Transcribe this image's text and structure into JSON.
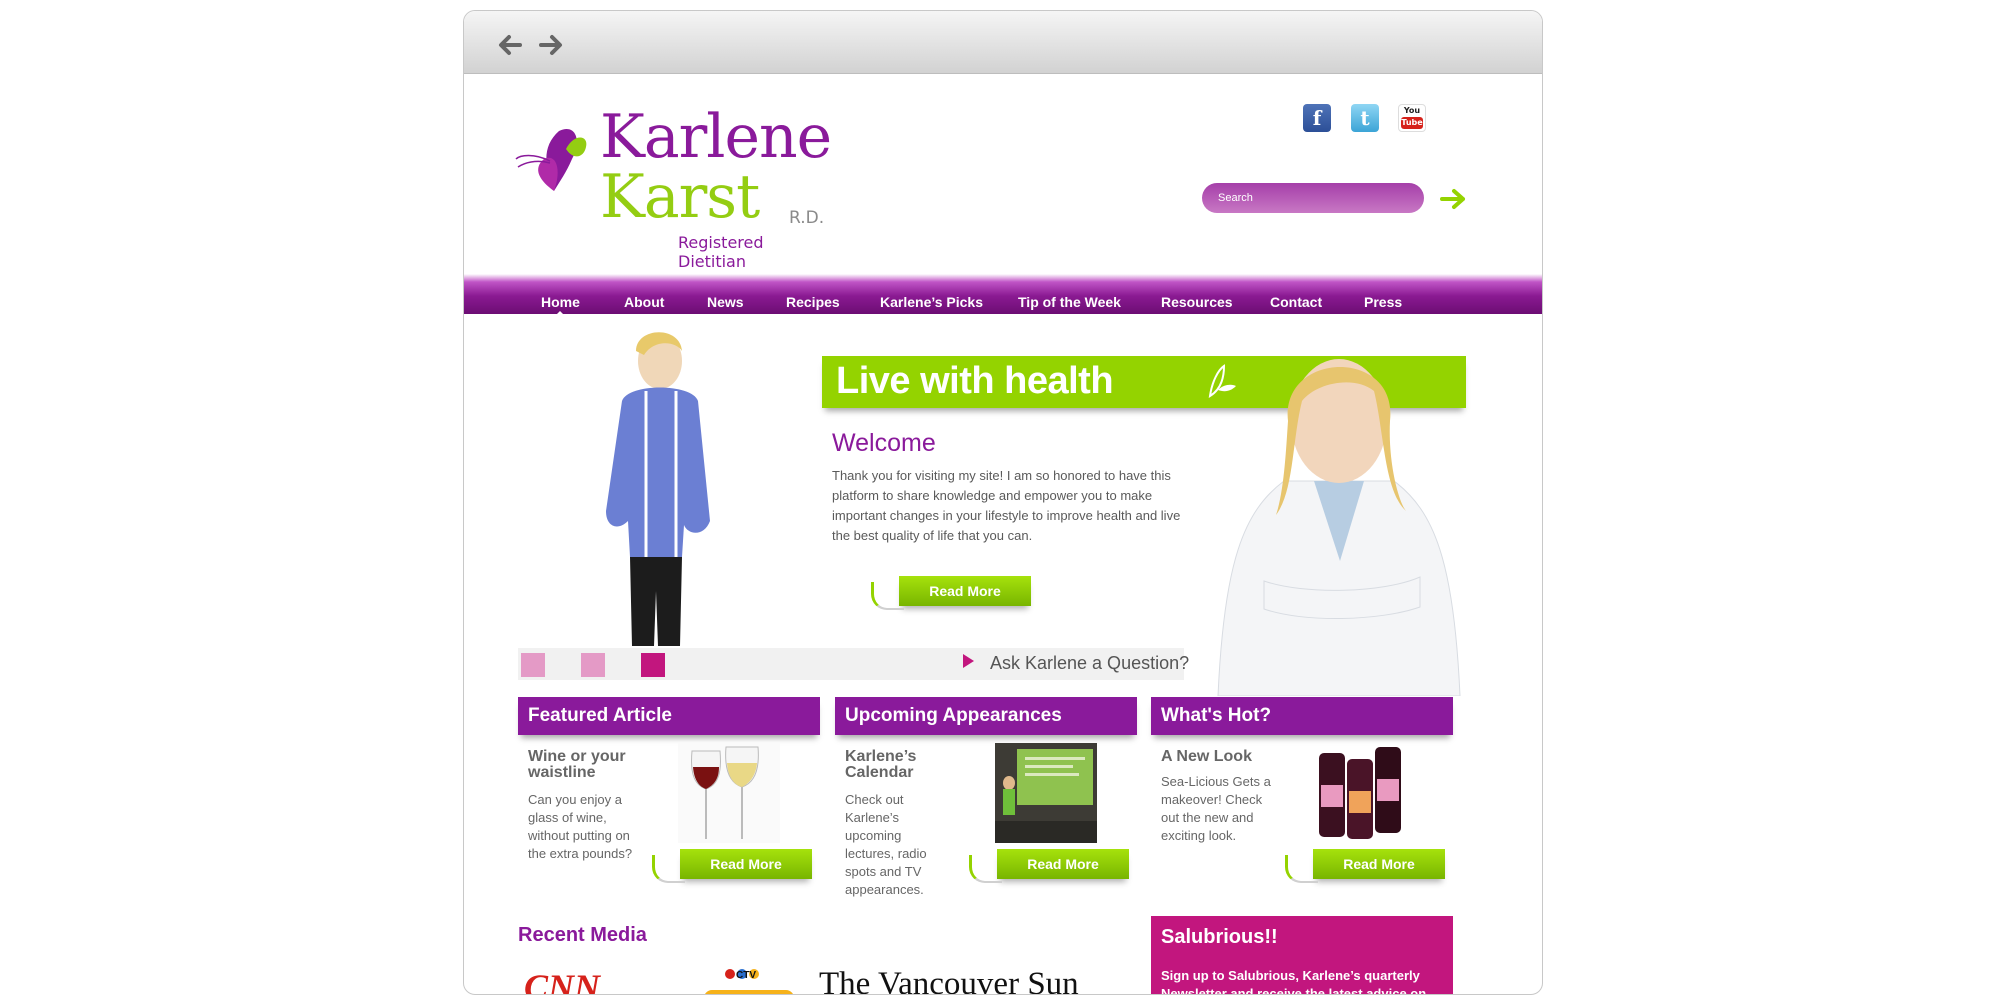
{
  "browser": {
    "back_icon": "back-arrow-icon",
    "forward_icon": "forward-arrow-icon"
  },
  "logo": {
    "first_name": "Karlene",
    "last_name": "Karst",
    "credential": "R.D.",
    "subtitle": "Registered Dietitian"
  },
  "social": [
    {
      "name": "facebook-icon",
      "glyph": "f"
    },
    {
      "name": "twitter-icon",
      "glyph": "t"
    },
    {
      "name": "youtube-icon",
      "top": "You",
      "bottom": "Tube"
    }
  ],
  "search": {
    "placeholder": "Search"
  },
  "nav": {
    "items": [
      {
        "label": "Home",
        "active": true
      },
      {
        "label": "About"
      },
      {
        "label": "News"
      },
      {
        "label": "Recipes"
      },
      {
        "label": "Karlene’s Picks"
      },
      {
        "label": "Tip of the Week"
      },
      {
        "label": "Resources"
      },
      {
        "label": "Contact"
      },
      {
        "label": "Press"
      }
    ]
  },
  "hero": {
    "banner": "Live with health",
    "welcome_title": "Welcome",
    "welcome_text": "Thank you for visiting my site! I am so honored to have this platform to share knowledge and empower you to make important changes in your lifestyle to improve health and live the best quality of life that you can.",
    "read_more": "Read More",
    "ask": "Ask Karlene a Question?",
    "dot_colors": [
      "#e49ac6",
      "#e49ac6",
      "#c2167e"
    ]
  },
  "columns": [
    {
      "title": "Featured Article",
      "subtitle": "Wine or your waistline",
      "body": "Can you enjoy a glass of wine, without putting on the extra pounds?",
      "button": "Read More"
    },
    {
      "title": "Upcoming Appearances",
      "subtitle": "Karlene’s Calendar",
      "body": "Check out Karlene’s upcoming lectures, radio spots and TV appearances.",
      "button": "Read More"
    },
    {
      "title": "What's Hot?",
      "subtitle": "A New Look",
      "body": "Sea-Licious Gets a makeover! Check out the new and exciting look.",
      "button": "Read More"
    }
  ],
  "recent_media": {
    "title": "Recent Media",
    "logos": [
      "CNN",
      "CTV",
      "The Vancouver Sun"
    ]
  },
  "salubrious": {
    "title": "Salubrious!!",
    "text": "Sign up to Salubrious, Karlene’s quarterly Newsletter and receive the latest advice on"
  },
  "colors": {
    "purple": "#8a1a9b",
    "green": "#94d300",
    "magenta": "#c2167e"
  }
}
